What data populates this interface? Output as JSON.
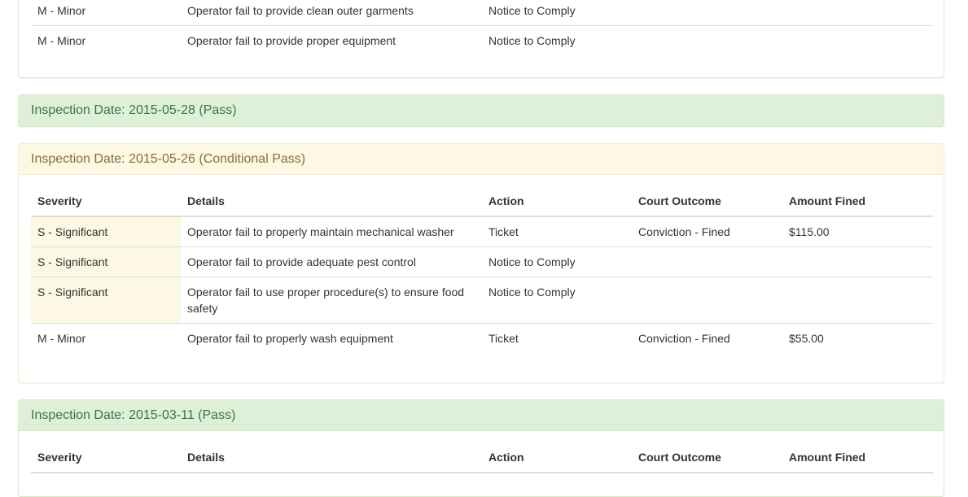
{
  "columns": {
    "severity": "Severity",
    "details": "Details",
    "action": "Action",
    "court_outcome": "Court Outcome",
    "amount_fined": "Amount Fined"
  },
  "top_panel": {
    "rows": [
      {
        "severity": "M - Minor",
        "details": "Operator fail to provide clean outer garments",
        "action": "Notice to Comply",
        "court_outcome": "",
        "amount_fined": ""
      },
      {
        "severity": "M - Minor",
        "details": "Operator fail to provide proper equipment",
        "action": "Notice to Comply",
        "court_outcome": "",
        "amount_fined": ""
      }
    ]
  },
  "inspection_2015_05_28": {
    "title": "Inspection Date: 2015-05-28 (Pass)"
  },
  "inspection_2015_05_26": {
    "title": "Inspection Date: 2015-05-26 (Conditional Pass)",
    "rows": [
      {
        "severity": "S - Significant",
        "details": "Operator fail to properly maintain mechanical washer",
        "action": "Ticket",
        "court_outcome": "Conviction - Fined",
        "amount_fined": "$115.00"
      },
      {
        "severity": "S - Significant",
        "details": "Operator fail to provide adequate pest control",
        "action": "Notice to Comply",
        "court_outcome": "",
        "amount_fined": ""
      },
      {
        "severity": "S - Significant",
        "details": "Operator fail to use proper procedure(s) to ensure food safety",
        "action": "Notice to Comply",
        "court_outcome": "",
        "amount_fined": ""
      },
      {
        "severity": "M - Minor",
        "details": "Operator fail to properly wash equipment",
        "action": "Ticket",
        "court_outcome": "Conviction - Fined",
        "amount_fined": "$55.00"
      }
    ]
  },
  "inspection_2015_03_11": {
    "title": "Inspection Date: 2015-03-11 (Pass)"
  },
  "colors": {
    "success_bg": "#dff0d8",
    "success_text": "#3c763d",
    "warning_bg": "#fcf8e3",
    "warning_text": "#8a6d3b"
  }
}
